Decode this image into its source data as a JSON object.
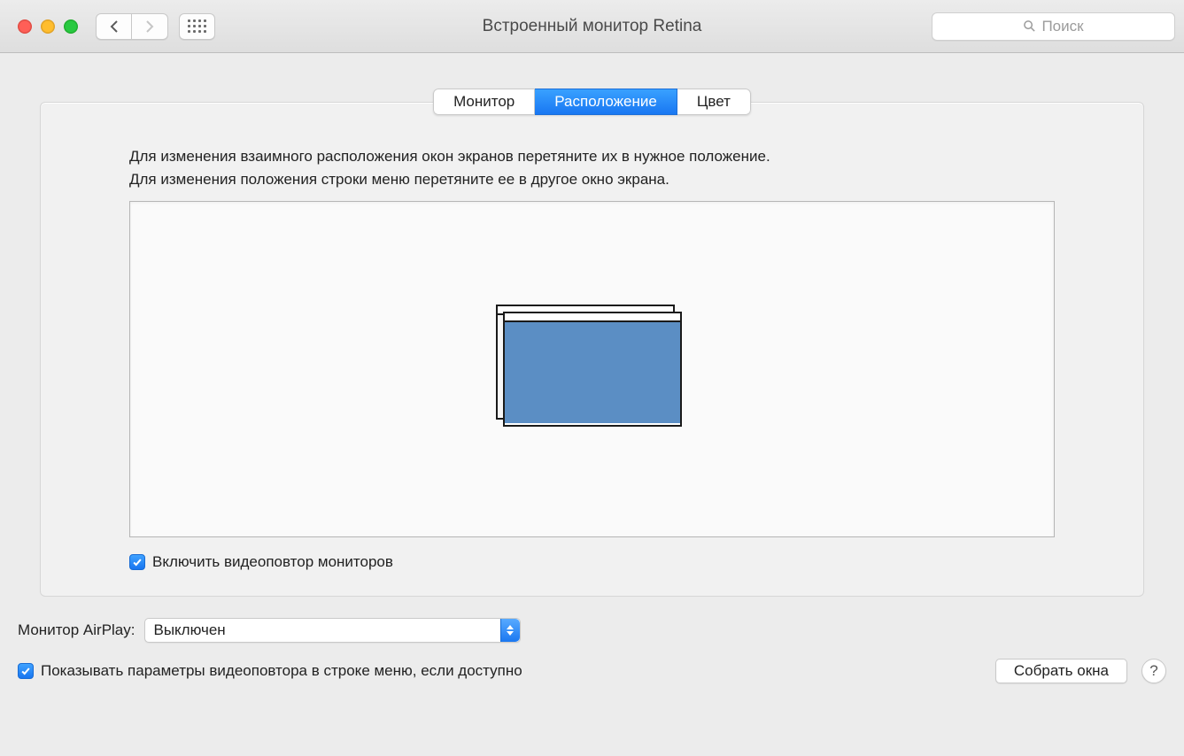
{
  "window": {
    "title": "Встроенный монитор Retina",
    "search_placeholder": "Поиск"
  },
  "tabs": {
    "monitor": "Монитор",
    "arrangement": "Расположение",
    "color": "Цвет",
    "active_index": 1
  },
  "panel": {
    "instruction_line1": "Для изменения взаимного расположения окон экранов перетяните их в нужное положение.",
    "instruction_line2": "Для изменения положения строки меню перетяните ее в другое окно экрана.",
    "mirror_checkbox_label": "Включить видеоповтор мониторов",
    "mirror_checked": true
  },
  "airplay": {
    "label": "Монитор AirPlay:",
    "selected": "Выключен"
  },
  "footer": {
    "show_mirror_in_menu_label": "Показывать параметры видеоповтора в строке меню, если доступно",
    "show_mirror_checked": true,
    "gather_windows_button": "Собрать окна",
    "help_label": "?"
  }
}
